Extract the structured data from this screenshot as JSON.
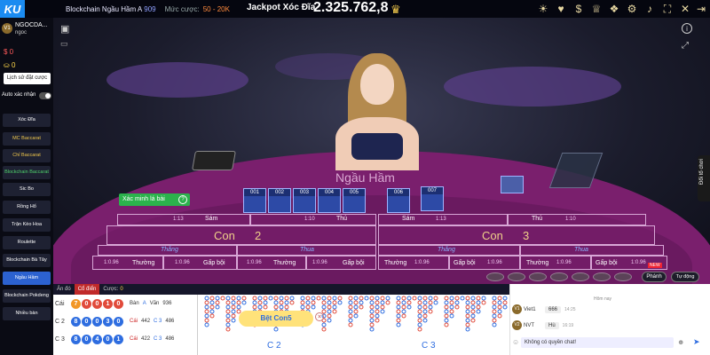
{
  "topbar": {
    "logo": "KU",
    "table_name": "Blockchain Ngầu Hầm A",
    "table_id": "909",
    "bet_label": "Mức cược:",
    "bet_range": "50 - 20K",
    "jackpot_label": "Jackpot Xóc Đĩa",
    "jackpot_value": "2.325.762,8"
  },
  "user": {
    "vip": "V1",
    "name": "NGOCDA...",
    "sub": "ngoc",
    "balance_1": "0",
    "balance_2": "0",
    "history_button": "Lịch sử đặt cược",
    "auto_confirm_label": "Auto xác nhận"
  },
  "games": [
    "Xóc Đĩa",
    "MC Baccarat",
    "Chỉ Baccarat",
    "Blockchain Baccarat",
    "Sic Bo",
    "Rồng Hổ",
    "Trận Kèo Hoa",
    "Roulette",
    "Blockchain Bà Tây",
    "Ngầu Hầm",
    "Blockchain Pokdeng",
    "Nhiều bàn"
  ],
  "scene": {
    "dealer_label": "Ngầu Hầm",
    "verify_button": "Xác minh lá bài",
    "change_table": "Đổi tổ chơi",
    "cards": [
      "001",
      "002",
      "003",
      "004",
      "005",
      "006",
      "007"
    ]
  },
  "grid": {
    "left": {
      "odds_1": "1:13",
      "sam": "Sám",
      "odds_2": "1:10",
      "thu": "Thú",
      "con": "Con",
      "num": "2",
      "thang": "Thắng",
      "thua": "Thua",
      "r1": "1:0.96",
      "t1": "Thường",
      "r2": "1:0.96",
      "g1": "Gấp bội",
      "r3": "1:0.96",
      "t2": "Thường",
      "r4": "1:0.96",
      "g2": "Gấp bội"
    },
    "right": {
      "sam": "Sám",
      "odds_1": "1:13",
      "thu": "Thú",
      "odds_2": "1:10",
      "con": "Con",
      "num": "3",
      "thang": "Thắng",
      "thua": "Thua",
      "t1": "Thường",
      "r1": "1:0.96",
      "g1": "Gấp bội",
      "r2": "1:0.96",
      "t2": "Thường",
      "r3": "1:0.96",
      "g2": "Gấp bội",
      "r4": "1:0.96"
    },
    "new_badge": "NEW",
    "double_button": "Phánh",
    "rebet_button": "Tự động"
  },
  "bottom": {
    "tab_1": "Ản đó",
    "tab_2": "Cổ điển",
    "tab_3": "Cược:",
    "tab_3_val": "0",
    "rows": [
      {
        "label": "Cái",
        "balls": [
          "7",
          "0",
          "0",
          "1",
          "0"
        ],
        "c1": "Bàn",
        "c2": "A",
        "c3": "Văn",
        "c4": "936"
      },
      {
        "label": "C 2",
        "balls": [
          "8",
          "0",
          "0",
          "3",
          "0"
        ],
        "c1": "Cái",
        "c2": "442",
        "c3": "C 3",
        "c4": "486"
      },
      {
        "label": "C 3",
        "balls": [
          "8",
          "0",
          "4",
          "0",
          "1"
        ],
        "c1": "Cái",
        "c2": "422",
        "c3": "C 3",
        "c4": "486"
      }
    ],
    "bet_tag": "Bệt Con5",
    "col_c2": "C 2",
    "col_c3": "C 3"
  },
  "chat": {
    "today": "Hôm nay",
    "messages": [
      {
        "vip": "V1",
        "name": "Viet1",
        "text": "666",
        "time": "14:25"
      },
      {
        "vip": "V2",
        "name": "NVT",
        "text": "Hù",
        "time": "16:19"
      }
    ],
    "input_placeholder": "Không có quyền chat!"
  }
}
